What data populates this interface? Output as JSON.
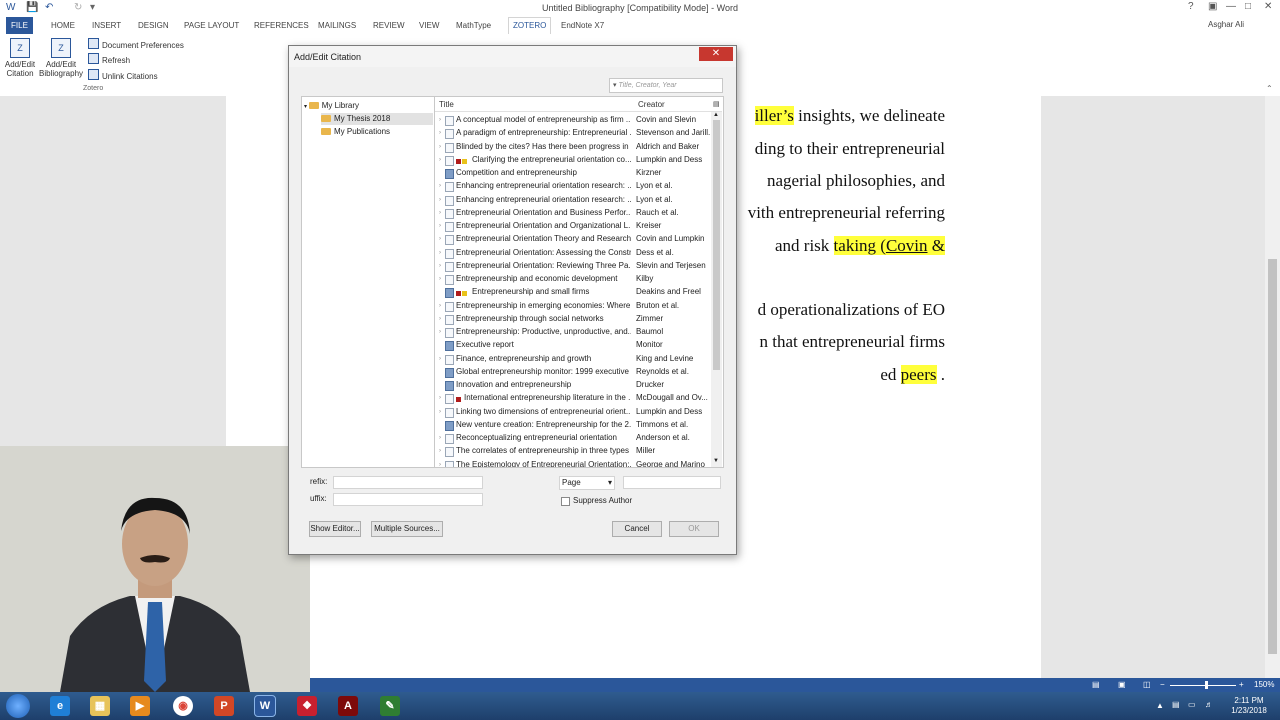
{
  "window": {
    "title": "Untitled Bibliography [Compatibility Mode] - Word",
    "user": "Asghar Ali",
    "controls": [
      "?",
      "▣",
      "—",
      "□",
      "✕"
    ]
  },
  "ribbon_tabs": [
    "FILE",
    "HOME",
    "INSERT",
    "DESIGN",
    "PAGE LAYOUT",
    "REFERENCES",
    "MAILINGS",
    "REVIEW",
    "VIEW",
    "MathType",
    "ZOTERO",
    "EndNote X7"
  ],
  "active_tab": "ZOTERO",
  "ribbon": {
    "add_edit_citation": "Add/Edit Citation",
    "add_edit_bibliography": "Add/Edit Bibliography",
    "document_preferences": "Document Preferences",
    "refresh": "Refresh",
    "unlink_citations": "Unlink Citations",
    "group_label": "Zotero"
  },
  "document": {
    "lines": [
      [
        {
          "t": "iller’s",
          "hl": true
        },
        {
          "t": " insights, we delineate"
        }
      ],
      [
        {
          "t": "ding to their entrepreneurial"
        }
      ],
      [
        {
          "t": "nagerial philosophies, and"
        }
      ],
      [
        {
          "t": "vith entrepreneurial referring"
        }
      ],
      [
        {
          "t": "and risk "
        },
        {
          "t": "taking (",
          "hl": true
        },
        {
          "t": "Covin",
          "hl": true,
          "ul": true
        },
        {
          "t": " &",
          "hl": true
        }
      ],
      [
        {
          "t": ""
        }
      ],
      [
        {
          "t": "d operationalizations of EO"
        }
      ],
      [
        {
          "t": "n that entrepreneurial firms"
        }
      ],
      [
        {
          "t": "ed "
        },
        {
          "t": "peers",
          "hl": true
        },
        {
          "t": " ."
        }
      ]
    ]
  },
  "dialog": {
    "title": "Add/Edit Citation",
    "close": "✕",
    "search_placeholder": "Title, Creator, Year",
    "tree": [
      {
        "label": "My Library",
        "level": 0
      },
      {
        "label": "My Thesis 2018",
        "level": 1,
        "selected": true
      },
      {
        "label": "My Publications",
        "level": 1
      }
    ],
    "columns": {
      "title": "Title",
      "creator": "Creator"
    },
    "items": [
      {
        "title": "A conceptual model of entrepreneurship as firm ...",
        "creator": "Covin and Slevin",
        "icon": "doc"
      },
      {
        "title": "A paradigm of entrepreneurship: Entrepreneurial ...",
        "creator": "Stevenson and Jarill...",
        "icon": "doc"
      },
      {
        "title": "Blinded by the cites? Has there been progress in ...",
        "creator": "Aldrich and Baker",
        "icon": "doc"
      },
      {
        "title": "Clarifying the entrepreneurial orientation co...",
        "creator": "Lumpkin and Dess",
        "icon": "doc",
        "tags": [
          "#b01b1b",
          "#e9c21a"
        ]
      },
      {
        "title": "Competition and entrepreneurship",
        "creator": "Kirzner",
        "icon": "book"
      },
      {
        "title": "Enhancing entrepreneurial orientation research: ...",
        "creator": "Lyon et al.",
        "icon": "doc"
      },
      {
        "title": "Enhancing entrepreneurial orientation research: ...",
        "creator": "Lyon et al.",
        "icon": "doc"
      },
      {
        "title": "Entrepreneurial Orientation and Business Perfor...",
        "creator": "Rauch et al.",
        "icon": "doc"
      },
      {
        "title": "Entrepreneurial Orientation and Organizational L...",
        "creator": "Kreiser",
        "icon": "doc"
      },
      {
        "title": "Entrepreneurial Orientation Theory and Research...",
        "creator": "Covin and Lumpkin",
        "icon": "doc"
      },
      {
        "title": "Entrepreneurial Orientation: Assessing the Constr...",
        "creator": "Dess et al.",
        "icon": "doc"
      },
      {
        "title": "Entrepreneurial Orientation: Reviewing Three Pa...",
        "creator": "Slevin and Terjesen",
        "icon": "doc"
      },
      {
        "title": "Entrepreneurship and economic development",
        "creator": "Kilby",
        "icon": "doc"
      },
      {
        "title": "Entrepreneurship and small firms",
        "creator": "Deakins and Freel",
        "icon": "book",
        "tags": [
          "#b01b1b",
          "#e9c21a"
        ]
      },
      {
        "title": "Entrepreneurship in emerging economies: Where...",
        "creator": "Bruton et al.",
        "icon": "doc"
      },
      {
        "title": "Entrepreneurship through social networks",
        "creator": "Zimmer",
        "icon": "doc"
      },
      {
        "title": "Entrepreneurship: Productive, unproductive, and...",
        "creator": "Baumol",
        "icon": "doc"
      },
      {
        "title": "Executive report",
        "creator": "Monitor",
        "icon": "book"
      },
      {
        "title": "Finance, entrepreneurship and growth",
        "creator": "King and Levine",
        "icon": "doc"
      },
      {
        "title": "Global entrepreneurship monitor: 1999 executive ...",
        "creator": "Reynolds et al.",
        "icon": "book"
      },
      {
        "title": "Innovation and entrepreneurship",
        "creator": "Drucker",
        "icon": "book"
      },
      {
        "title": "International entrepreneurship literature in the ...",
        "creator": "McDougall and Ov...",
        "icon": "doc",
        "tags": [
          "#b01b1b"
        ]
      },
      {
        "title": "Linking two dimensions of entrepreneurial orient...",
        "creator": "Lumpkin and Dess",
        "icon": "doc"
      },
      {
        "title": "New venture creation: Entrepreneurship for the 2...",
        "creator": "Timmons et al.",
        "icon": "book"
      },
      {
        "title": "Reconceptualizing entrepreneurial orientation",
        "creator": "Anderson et al.",
        "icon": "doc"
      },
      {
        "title": "The correlates of entrepreneurship in three types ...",
        "creator": "Miller",
        "icon": "doc"
      },
      {
        "title": "The Epistemology of Entrepreneurial Orientation:...",
        "creator": "George and Marino",
        "icon": "doc"
      }
    ],
    "prefix_label": "refix:",
    "suffix_label": "uffix:",
    "locator_select": "Page",
    "suppress_author": "Suppress Author",
    "show_editor": "Show Editor...",
    "multiple_sources": "Multiple Sources...",
    "cancel": "Cancel",
    "ok": "OK"
  },
  "statusbar": {
    "zoom": "150%"
  },
  "taskbar": {
    "time": "2:11 PM",
    "date": "1/23/2018",
    "apps": [
      "internet-explorer",
      "file-explorer",
      "media-player",
      "chrome",
      "powerpoint",
      "word",
      "pdf-reader",
      "acrobat",
      "notepad"
    ]
  },
  "colors": {
    "word_blue": "#2b579a",
    "highlight": "#ffff3b",
    "close_red": "#c7372f"
  }
}
